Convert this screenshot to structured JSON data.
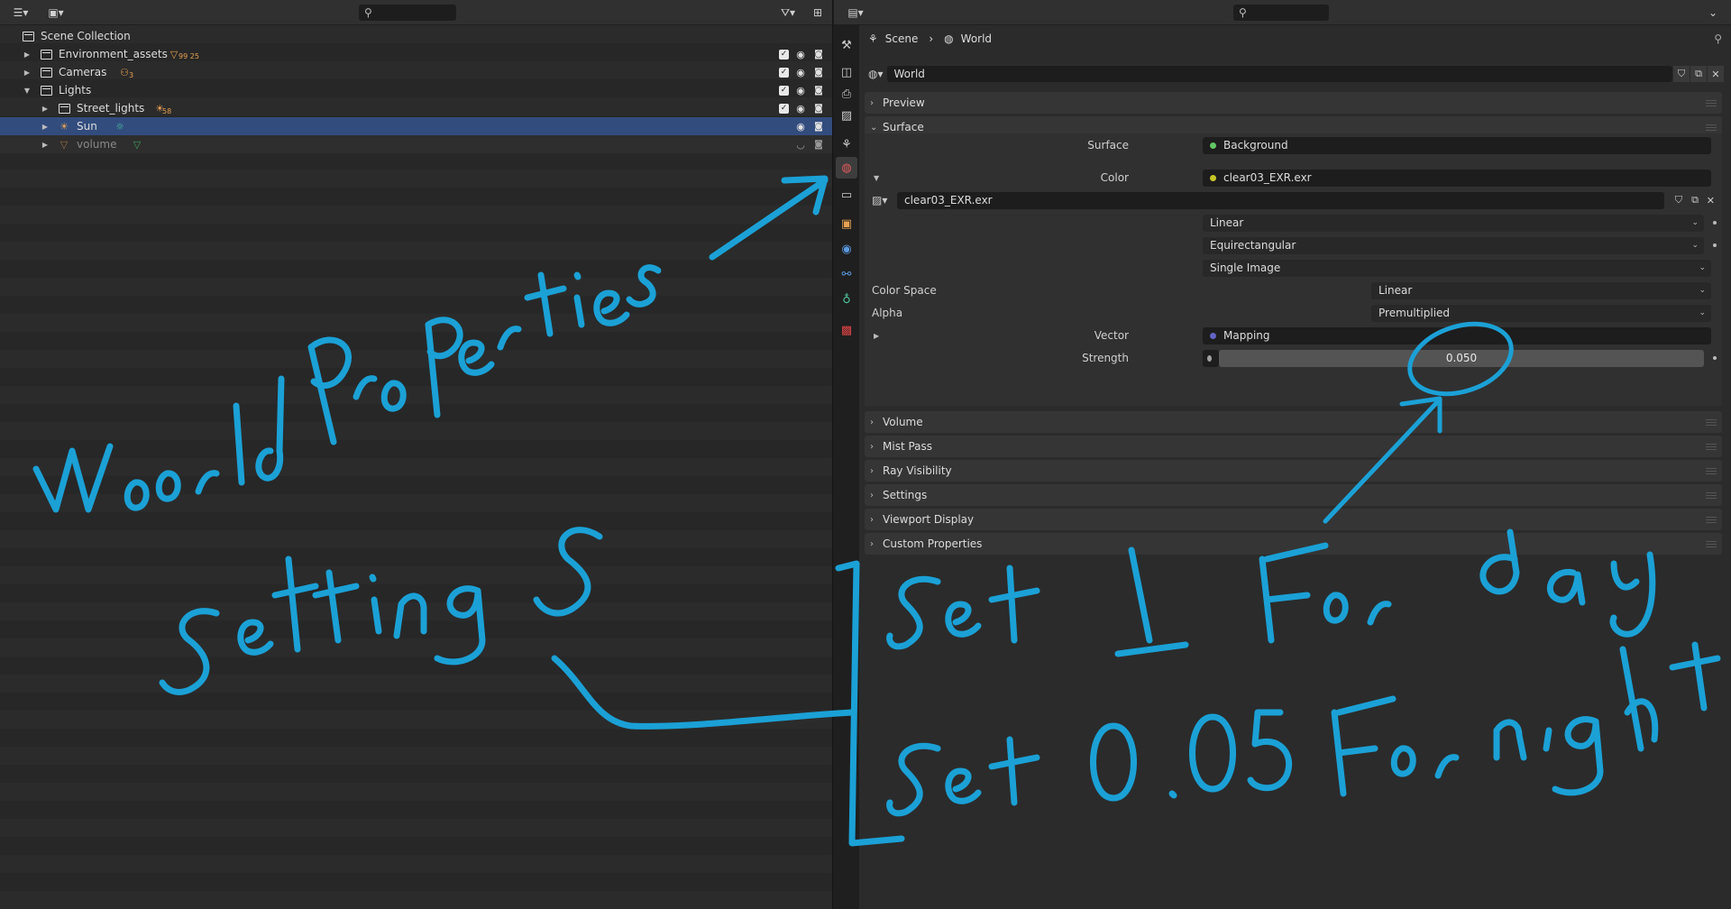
{
  "outliner": {
    "search_placeholder": "",
    "rows": [
      {
        "label": "Scene Collection"
      },
      {
        "label": "Environment_assets",
        "chip": "99 25"
      },
      {
        "label": "Cameras",
        "chip": "3"
      },
      {
        "label": "Lights"
      },
      {
        "label": "Street_lights",
        "chip": "58"
      },
      {
        "label": "Sun"
      },
      {
        "label": "volume"
      }
    ]
  },
  "properties": {
    "breadcrumb": {
      "scene": "Scene",
      "world": "World"
    },
    "world_name": "World",
    "panels": {
      "preview": "Preview",
      "surface": "Surface",
      "volume": "Volume",
      "mist_pass": "Mist Pass",
      "ray_visibility": "Ray Visibility",
      "settings": "Settings",
      "viewport_display": "Viewport Display",
      "custom_properties": "Custom Properties"
    },
    "surface": {
      "surface_label": "Surface",
      "surface_value": "Background",
      "color_label": "Color",
      "color_value": "clear03_EXR.exr",
      "image_name": "clear03_EXR.exr",
      "interpolation": "Linear",
      "projection": "Equirectangular",
      "source": "Single Image",
      "color_space_label": "Color Space",
      "color_space_value": "Linear",
      "alpha_label": "Alpha",
      "alpha_value": "Premultiplied",
      "vector_label": "Vector",
      "vector_value": "Mapping",
      "strength_label": "Strength",
      "strength_value": "0.050"
    },
    "colors": {
      "shader_dot": "#63c763",
      "color_dot": "#c7c729",
      "vector_dot": "#6363c7",
      "value_dot": "#a1a1a1",
      "selected_row": "#324c7e",
      "annotation": "#1ba1d6"
    }
  }
}
